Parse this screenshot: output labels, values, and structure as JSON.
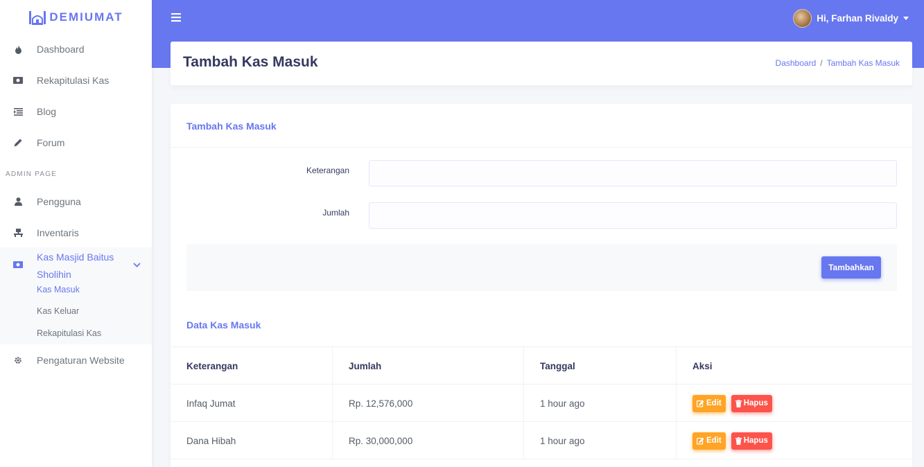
{
  "brand": {
    "name": "DEMIUMAT"
  },
  "sidebar": {
    "items": [
      {
        "label": "Dashboard",
        "icon": "fire-icon"
      },
      {
        "label": "Rekapitulasi Kas",
        "icon": "money-icon"
      },
      {
        "label": "Blog",
        "icon": "list-icon"
      },
      {
        "label": "Forum",
        "icon": "pencil-icon"
      }
    ],
    "admin_header": "ADMIN PAGE",
    "admin_items": [
      {
        "label": "Pengguna",
        "icon": "user-icon"
      },
      {
        "label": "Inventaris",
        "icon": "inventory-icon"
      }
    ],
    "active": {
      "label": "Kas Masjid Baitus Sholihin",
      "icon": "money-icon"
    },
    "sub_items": [
      {
        "label": "Kas Masuk"
      },
      {
        "label": "Kas Keluar"
      },
      {
        "label": "Rekapitulasi Kas"
      }
    ],
    "settings": {
      "label": "Pengaturan Website",
      "icon": "gear-icon"
    }
  },
  "topbar": {
    "user": "Hi, Farhan Rivaldy"
  },
  "header": {
    "title": "Tambah Kas Masuk",
    "breadcrumb": [
      "Dashboard",
      "Tambah Kas Masuk"
    ]
  },
  "form": {
    "title": "Tambah Kas Masuk",
    "fields": [
      {
        "label": "Keterangan",
        "value": ""
      },
      {
        "label": "Jumlah",
        "value": ""
      }
    ],
    "submit": "Tambahkan"
  },
  "table": {
    "title": "Data Kas Masuk",
    "columns": [
      "Keterangan",
      "Jumlah",
      "Tanggal",
      "Aksi"
    ],
    "rows": [
      {
        "keterangan": "Infaq Jumat",
        "jumlah": "Rp. 12,576,000",
        "tanggal": "1 hour ago"
      },
      {
        "keterangan": "Dana Hibah",
        "jumlah": "Rp. 30,000,000",
        "tanggal": "1 hour ago"
      }
    ],
    "edit_label": "Edit",
    "delete_label": "Hapus"
  },
  "colors": {
    "primary": "#6777ef",
    "warning": "#ffa426",
    "danger": "#fc544b"
  }
}
